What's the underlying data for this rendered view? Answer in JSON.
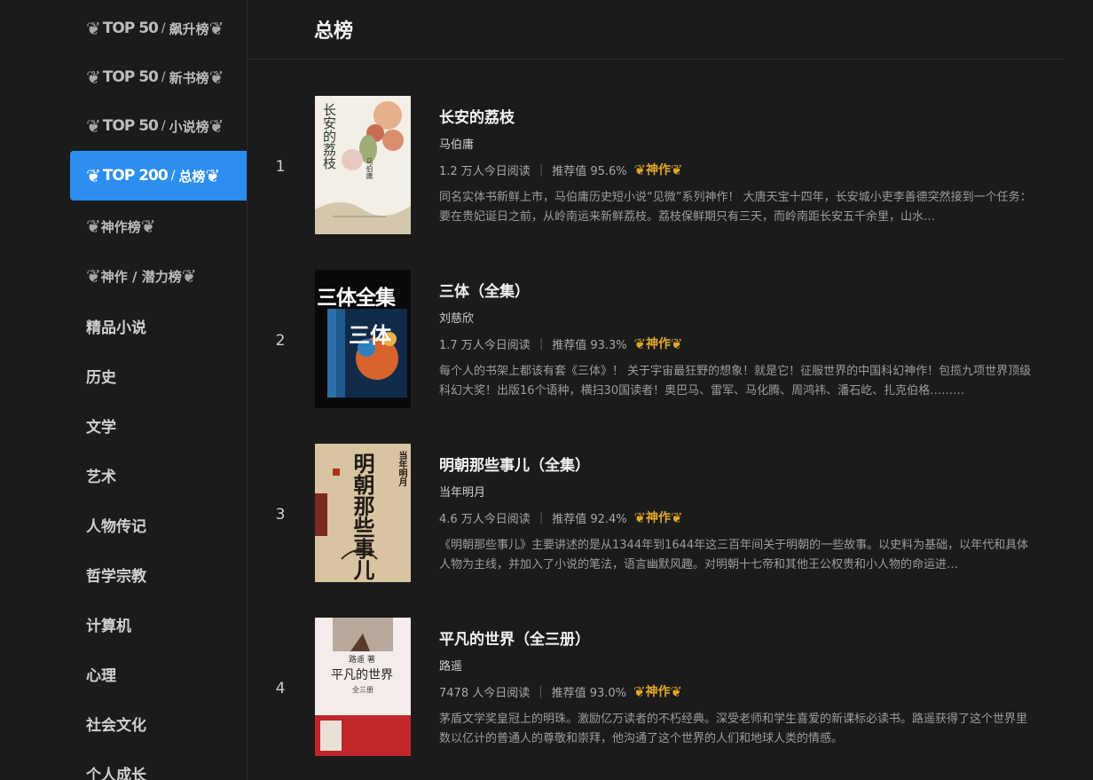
{
  "sidebar": {
    "items": [
      {
        "type": "badge",
        "top": "TOP 50",
        "sub": "飙升榜",
        "active": false
      },
      {
        "type": "badge",
        "top": "TOP 50",
        "sub": "新书榜",
        "active": false
      },
      {
        "type": "badge",
        "top": "TOP 50",
        "sub": "小说榜",
        "active": false
      },
      {
        "type": "badge",
        "top": "TOP 200",
        "sub": "总榜",
        "active": true
      },
      {
        "type": "badge",
        "top": "",
        "sub": "神作榜",
        "active": false
      },
      {
        "type": "badge",
        "top": "",
        "sub": "神作 / 潜力榜",
        "active": false
      },
      {
        "type": "plain",
        "label": "精品小说"
      },
      {
        "type": "plain",
        "label": "历史"
      },
      {
        "type": "plain",
        "label": "文学"
      },
      {
        "type": "plain",
        "label": "艺术"
      },
      {
        "type": "plain",
        "label": "人物传记"
      },
      {
        "type": "plain",
        "label": "哲学宗教"
      },
      {
        "type": "plain",
        "label": "计算机"
      },
      {
        "type": "plain",
        "label": "心理"
      },
      {
        "type": "plain",
        "label": "社会文化"
      },
      {
        "type": "plain",
        "label": "个人成长"
      }
    ],
    "slash": "/"
  },
  "main": {
    "title": "总榜",
    "shenzuo_label": "神作",
    "separator": "|",
    "books": [
      {
        "rank": "1",
        "title": "长安的荔枝",
        "author": "马伯庸",
        "readers": "1.2 万人今日阅读",
        "rating": "推荐值 95.6%",
        "desc": "同名实体书新鲜上市，马伯庸历史短小说“见微”系列神作！ 大唐天宝十四年，长安城小吏李善德突然接到一个任务：要在贵妃诞日之前，从岭南运来新鲜荔枝。荔枝保鲜期只有三天，而岭南距长安五千余里，山水…",
        "cover_text": "长安的荔枝",
        "cover_author": "马伯庸"
      },
      {
        "rank": "2",
        "title": "三体（全集）",
        "author": "刘慈欣",
        "readers": "1.7 万人今日阅读",
        "rating": "推荐值 93.3%",
        "desc": "每个人的书架上都该有套《三体》！ 关于宇宙最狂野的想象！就是它！征服世界的中国科幻神作！包揽九项世界顶级科幻大奖！出版16个语种，横扫30国读者！奥巴马、雷军、马化腾、周鸿祎、潘石屹、扎克伯格………",
        "cover_text": "三体全集",
        "cover_sub": "三体"
      },
      {
        "rank": "3",
        "title": "明朝那些事儿（全集）",
        "author": "当年明月",
        "readers": "4.6 万人今日阅读",
        "rating": "推荐值 92.4%",
        "desc": "《明朝那些事儿》主要讲述的是从1344年到1644年这三百年间关于明朝的一些故事。以史料为基础，以年代和具体人物为主线，并加入了小说的笔法，语言幽默风趣。对明朝十七帝和其他王公权贵和小人物的命运进…",
        "cover_text": "明朝那些事儿",
        "cover_author": "当年明月"
      },
      {
        "rank": "4",
        "title": "平凡的世界（全三册）",
        "author": "路遥",
        "readers": "7478 人今日阅读",
        "rating": "推荐值 93.0%",
        "desc": "茅盾文学奖皇冠上的明珠。激励亿万读者的不朽经典。深受老师和学生喜爱的新课标必读书。路遥获得了这个世界里数以亿计的普通人的尊敬和崇拜，他沟通了这个世界的人们和地球人类的情感。",
        "cover_text": "平凡的世界",
        "cover_author": "路遥 著",
        "cover_vol": "全三册"
      }
    ]
  },
  "colors": {
    "active": "#2b8ef0",
    "gold": "#e0a72b",
    "bg": "#1b1b1c"
  }
}
